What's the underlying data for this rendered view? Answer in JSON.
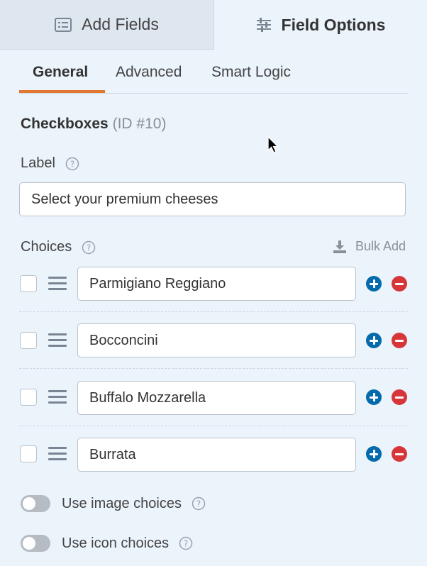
{
  "top_tabs": {
    "add_fields": "Add Fields",
    "field_options": "Field Options"
  },
  "sub_tabs": {
    "general": "General",
    "advanced": "Advanced",
    "smart_logic": "Smart Logic"
  },
  "field": {
    "name": "Checkboxes",
    "id_label": "(ID #10)"
  },
  "label": {
    "title": "Label",
    "value": "Select your premium cheeses"
  },
  "choices": {
    "title": "Choices",
    "bulk_add": "Bulk Add",
    "items": [
      {
        "value": "Parmigiano Reggiano",
        "checked": false
      },
      {
        "value": "Bocconcini",
        "checked": false
      },
      {
        "value": "Buffalo Mozzarella",
        "checked": false
      },
      {
        "value": "Burrata",
        "checked": false
      }
    ]
  },
  "toggles": {
    "image_choices": {
      "label": "Use image choices",
      "enabled": false
    },
    "icon_choices": {
      "label": "Use icon choices",
      "enabled": false
    }
  },
  "colors": {
    "accent": "#e27730",
    "add": "#036aab",
    "remove": "#d63638"
  }
}
